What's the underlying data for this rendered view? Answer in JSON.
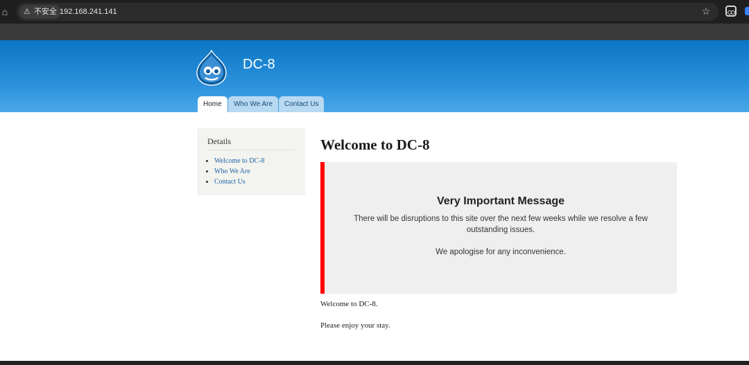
{
  "browser": {
    "security_label": "不安全",
    "warning_glyph": "⚠",
    "url": "192.168.241.141",
    "home_icon": "home-icon",
    "star_icon": "star-icon",
    "extension_icon": "extension-icon"
  },
  "site": {
    "name": "DC-8",
    "tabs": [
      {
        "label": "Home",
        "active": true
      },
      {
        "label": "Who We Are",
        "active": false
      },
      {
        "label": "Contact Us",
        "active": false
      }
    ]
  },
  "sidebar": {
    "title": "Details",
    "items": [
      {
        "label": "Welcome to DC-8"
      },
      {
        "label": "Who We Are"
      },
      {
        "label": "Contact Us"
      }
    ]
  },
  "main": {
    "title": "Welcome to DC-8",
    "message": {
      "heading": "Very Important Message",
      "line1": "There will be disruptions to this site over the next few weeks while we resolve a few outstanding issues.",
      "line2": "We apologise for any inconvenience."
    },
    "paragraphs": [
      "Welcome to DC-8.",
      "Please enjoy your stay."
    ]
  },
  "colors": {
    "header_blue": "#0b76c4",
    "alert_red": "#ff0000",
    "link_blue": "#1f62a6"
  }
}
